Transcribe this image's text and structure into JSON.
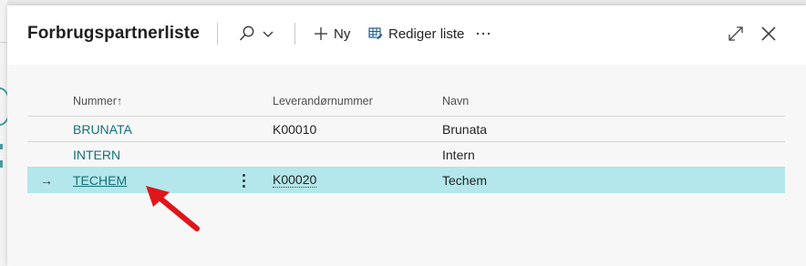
{
  "dialog": {
    "title": "Forbrugspartnerliste",
    "new_label": "Ny",
    "edit_list_label": "Rediger liste"
  },
  "columns": {
    "number": "Nummer",
    "sort_indicator": "↑",
    "vendor_number": "Leverandørnummer",
    "name": "Navn"
  },
  "rows": [
    {
      "number": "BRUNATA",
      "vendor_number": "K00010",
      "name": "Brunata",
      "selected": false
    },
    {
      "number": "INTERN",
      "vendor_number": "",
      "name": "Intern",
      "selected": false
    },
    {
      "number": "TECHEM",
      "vendor_number": "K00020",
      "name": "Techem",
      "selected": true
    }
  ],
  "row_indicator": "→",
  "colors": {
    "accent_link": "#15707a",
    "selected_row": "#b3e7eb",
    "annotation_arrow": "#e0161b"
  },
  "icons": [
    "search-icon",
    "chevron-down-icon",
    "plus-icon",
    "edit-list-icon",
    "more-icon",
    "expand-icon",
    "close-icon",
    "row-menu-icon",
    "annotation-arrow"
  ]
}
